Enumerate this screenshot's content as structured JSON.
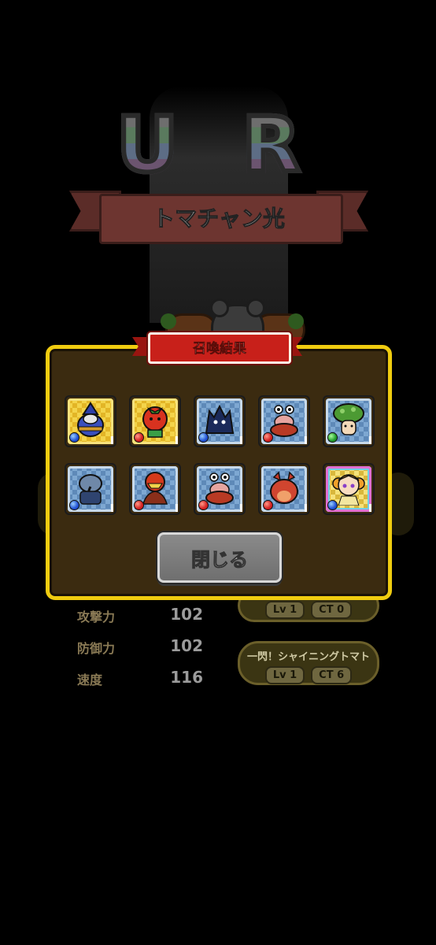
{
  "background": {
    "rarity": "U R",
    "character_name": "トマチャン光",
    "stats": [
      {
        "label": "攻撃力",
        "value": "102"
      },
      {
        "label": "防御力",
        "value": "102"
      },
      {
        "label": "速度",
        "value": "116"
      }
    ],
    "skills": [
      {
        "name": "",
        "level": "Lv 1",
        "ct": "CT 0"
      },
      {
        "name": "一閃！シャイニングトマト",
        "level": "Lv 1",
        "ct": "CT 6"
      }
    ]
  },
  "dialog": {
    "title": "召喚結果",
    "close_label": "閉じる",
    "cards": [
      {
        "frame": "gold",
        "orb": "blue",
        "creature": "blue-wizard-icon"
      },
      {
        "frame": "gold",
        "orb": "red",
        "creature": "tomato-icon"
      },
      {
        "frame": "blue",
        "orb": "blue",
        "creature": "dark-beast-icon"
      },
      {
        "frame": "blue",
        "orb": "red",
        "creature": "snail-icon"
      },
      {
        "frame": "blue",
        "orb": "green",
        "creature": "mushroom-icon"
      },
      {
        "frame": "blue",
        "orb": "blue",
        "creature": "elephant-knight-icon"
      },
      {
        "frame": "blue",
        "orb": "red",
        "creature": "plant-monster-icon"
      },
      {
        "frame": "blue",
        "orb": "red",
        "creature": "snail-icon"
      },
      {
        "frame": "blue",
        "orb": "red",
        "creature": "red-crab-icon"
      },
      {
        "frame": "rainbow",
        "orb": "blue",
        "creature": "tomato-girl-icon"
      }
    ]
  },
  "colors": {
    "dialog_border": "#f0cc10",
    "dialog_bg": "#3b2b10",
    "banner_red": "#c8201a",
    "close_button": "#7c7c7c"
  }
}
